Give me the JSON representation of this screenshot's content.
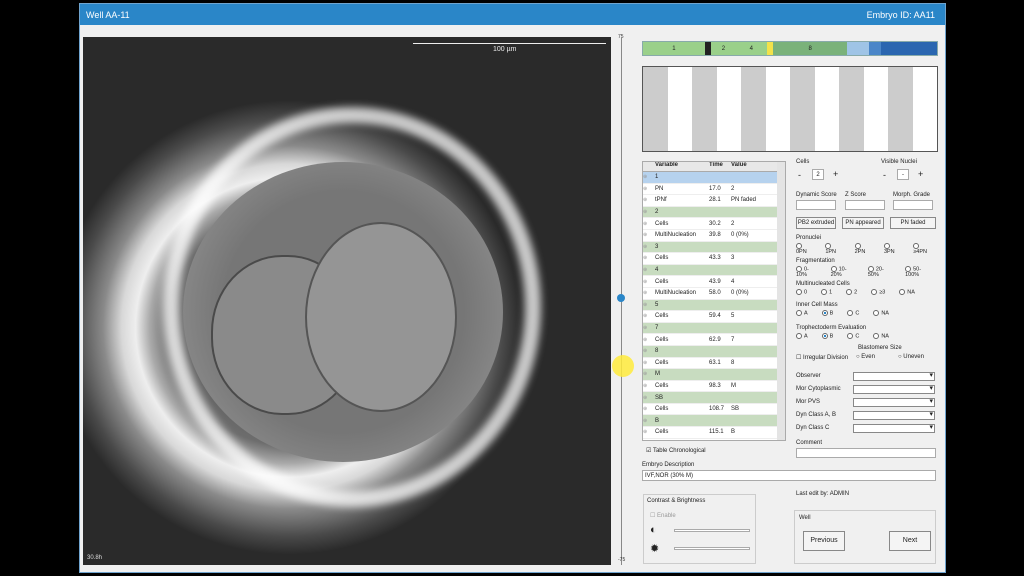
{
  "window": {
    "title": "Well AA-11",
    "embryo_id": "Embryo ID: AA11"
  },
  "viewer": {
    "scale_label": "100 µm",
    "timestamp": "30.8h"
  },
  "slider": {
    "top_tick": "75",
    "bottom_tick": "-75"
  },
  "timeline": {
    "segments": [
      {
        "label": "1",
        "color": "#9ad08a",
        "flex": 20
      },
      {
        "label": "",
        "color": "#222",
        "flex": 2
      },
      {
        "label": "2",
        "color": "#9ad08a",
        "flex": 8
      },
      {
        "label": "4",
        "color": "#9ad08a",
        "flex": 10
      },
      {
        "label": "",
        "color": "#f3e24a",
        "flex": 2
      },
      {
        "label": "8",
        "color": "#7ab27a",
        "flex": 24
      },
      {
        "label": "",
        "color": "#9fc4e6",
        "flex": 7
      },
      {
        "label": "",
        "color": "#4a86c8",
        "flex": 4
      },
      {
        "label": "",
        "color": "#2a66b0",
        "flex": 18
      }
    ]
  },
  "table": {
    "headers": [
      "Variable",
      "Time",
      "Value"
    ],
    "rows": [
      {
        "var": "1",
        "time": "",
        "val": "",
        "type": "selected"
      },
      {
        "var": "PN",
        "time": "17.0",
        "val": "2",
        "type": "row"
      },
      {
        "var": "tPNf",
        "time": "28.1",
        "val": "PN faded",
        "type": "row"
      },
      {
        "var": "2",
        "time": "",
        "val": "",
        "type": "group"
      },
      {
        "var": "Cells",
        "time": "30.2",
        "val": "2",
        "type": "row"
      },
      {
        "var": "MultiNucleation",
        "time": "39.8",
        "val": "0 (0%)",
        "type": "row"
      },
      {
        "var": "3",
        "time": "",
        "val": "",
        "type": "group"
      },
      {
        "var": "Cells",
        "time": "43.3",
        "val": "3",
        "type": "row"
      },
      {
        "var": "4",
        "time": "",
        "val": "",
        "type": "group"
      },
      {
        "var": "Cells",
        "time": "43.9",
        "val": "4",
        "type": "row"
      },
      {
        "var": "MultiNucleation",
        "time": "58.0",
        "val": "0 (0%)",
        "type": "row"
      },
      {
        "var": "5",
        "time": "",
        "val": "",
        "type": "group"
      },
      {
        "var": "Cells",
        "time": "59.4",
        "val": "5",
        "type": "row"
      },
      {
        "var": "7",
        "time": "",
        "val": "",
        "type": "group"
      },
      {
        "var": "Cells",
        "time": "62.9",
        "val": "7",
        "type": "row"
      },
      {
        "var": "8",
        "time": "",
        "val": "",
        "type": "group"
      },
      {
        "var": "Cells",
        "time": "63.1",
        "val": "8",
        "type": "row"
      },
      {
        "var": "M",
        "time": "",
        "val": "",
        "type": "group"
      },
      {
        "var": "Cells",
        "time": "98.3",
        "val": "M",
        "type": "row"
      },
      {
        "var": "SB",
        "time": "",
        "val": "",
        "type": "group"
      },
      {
        "var": "Cells",
        "time": "108.7",
        "val": "SB",
        "type": "row"
      },
      {
        "var": "B",
        "time": "",
        "val": "",
        "type": "group"
      },
      {
        "var": "Cells",
        "time": "115.1",
        "val": "B",
        "type": "row"
      }
    ]
  },
  "table_chronological": "Table Chronological",
  "embryo_description": {
    "label": "Embryo Description",
    "value": "IVF,NOR (30% M)"
  },
  "contrast": {
    "title": "Contrast & Brightness",
    "enable": "Enable"
  },
  "cells": {
    "label": "Cells",
    "minus": "-",
    "value": "2",
    "plus": "+"
  },
  "visible_nuclei": {
    "label": "Visible Nuclei",
    "minus": "-",
    "value": "-",
    "plus": "+"
  },
  "scores": {
    "dynamic": "Dynamic Score",
    "z": "Z Score",
    "morph": "Morph. Grade"
  },
  "buttons": {
    "pb2": "PB2 extruded",
    "pn_appeared": "PN appeared",
    "pn_faded": "PN faded",
    "previous": "Previous",
    "next": "Next"
  },
  "pronuclei": {
    "label": "Pronuclei",
    "options": [
      "0PN",
      "1PN",
      "2PN",
      "3PN",
      "≥4PN"
    ]
  },
  "fragmentation": {
    "label": "Fragmentation",
    "options": [
      "0-10%",
      "10-20%",
      "20-50%",
      "50-100%"
    ]
  },
  "multinucleated": {
    "label": "Multinucleated Cells",
    "options": [
      "0",
      "1",
      "2",
      "≥3",
      "NA"
    ]
  },
  "icm": {
    "label": "Inner Cell Mass",
    "options": [
      "A",
      "B",
      "C",
      "NA"
    ]
  },
  "te": {
    "label": "Trophectoderm Evaluation",
    "options": [
      "A",
      "B",
      "C",
      "NA"
    ]
  },
  "blastomere": {
    "label": "Blastomere Size",
    "irregular": "Irregular Division",
    "even": "Even",
    "uneven": "Uneven"
  },
  "dropdowns": [
    "Observer",
    "Mor Cytoplasmic",
    "Mor PVS",
    "Dyn Class A, B",
    "Dyn Class C"
  ],
  "comment": "Comment",
  "last_edit": "Last edit by: ADMIN",
  "well_group": "Well"
}
